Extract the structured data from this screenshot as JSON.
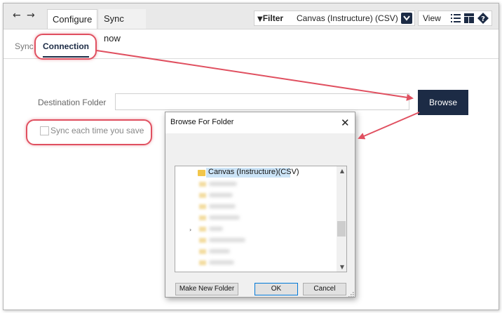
{
  "topbar": {
    "back_icon": "left-arrow-icon",
    "forward_icon": "right-arrow-icon",
    "tabs": [
      {
        "label": "Configure",
        "active": true
      },
      {
        "label": "Sync now",
        "active": false
      }
    ],
    "filter_label": "Filter",
    "filter_value": "Canvas (Instructure) (CSV)",
    "view_label": "View"
  },
  "subtabs": [
    {
      "label": "Sync"
    },
    {
      "label": "Connection",
      "active": true
    }
  ],
  "form": {
    "destination_label": "Destination Folder",
    "destination_value": "",
    "browse_label": "Browse",
    "sync_checkbox_label": "Sync each time you save",
    "sync_checked": false
  },
  "dialog": {
    "title": "Browse For Folder",
    "selected_folder": "Canvas (Instructure)(CSV)",
    "buttons": {
      "make_new_folder": "Make New Folder",
      "ok": "OK",
      "cancel": "Cancel"
    }
  },
  "colors": {
    "accent": "#1c2b45",
    "callout": "#e05060",
    "selection": "#cce4f7"
  }
}
